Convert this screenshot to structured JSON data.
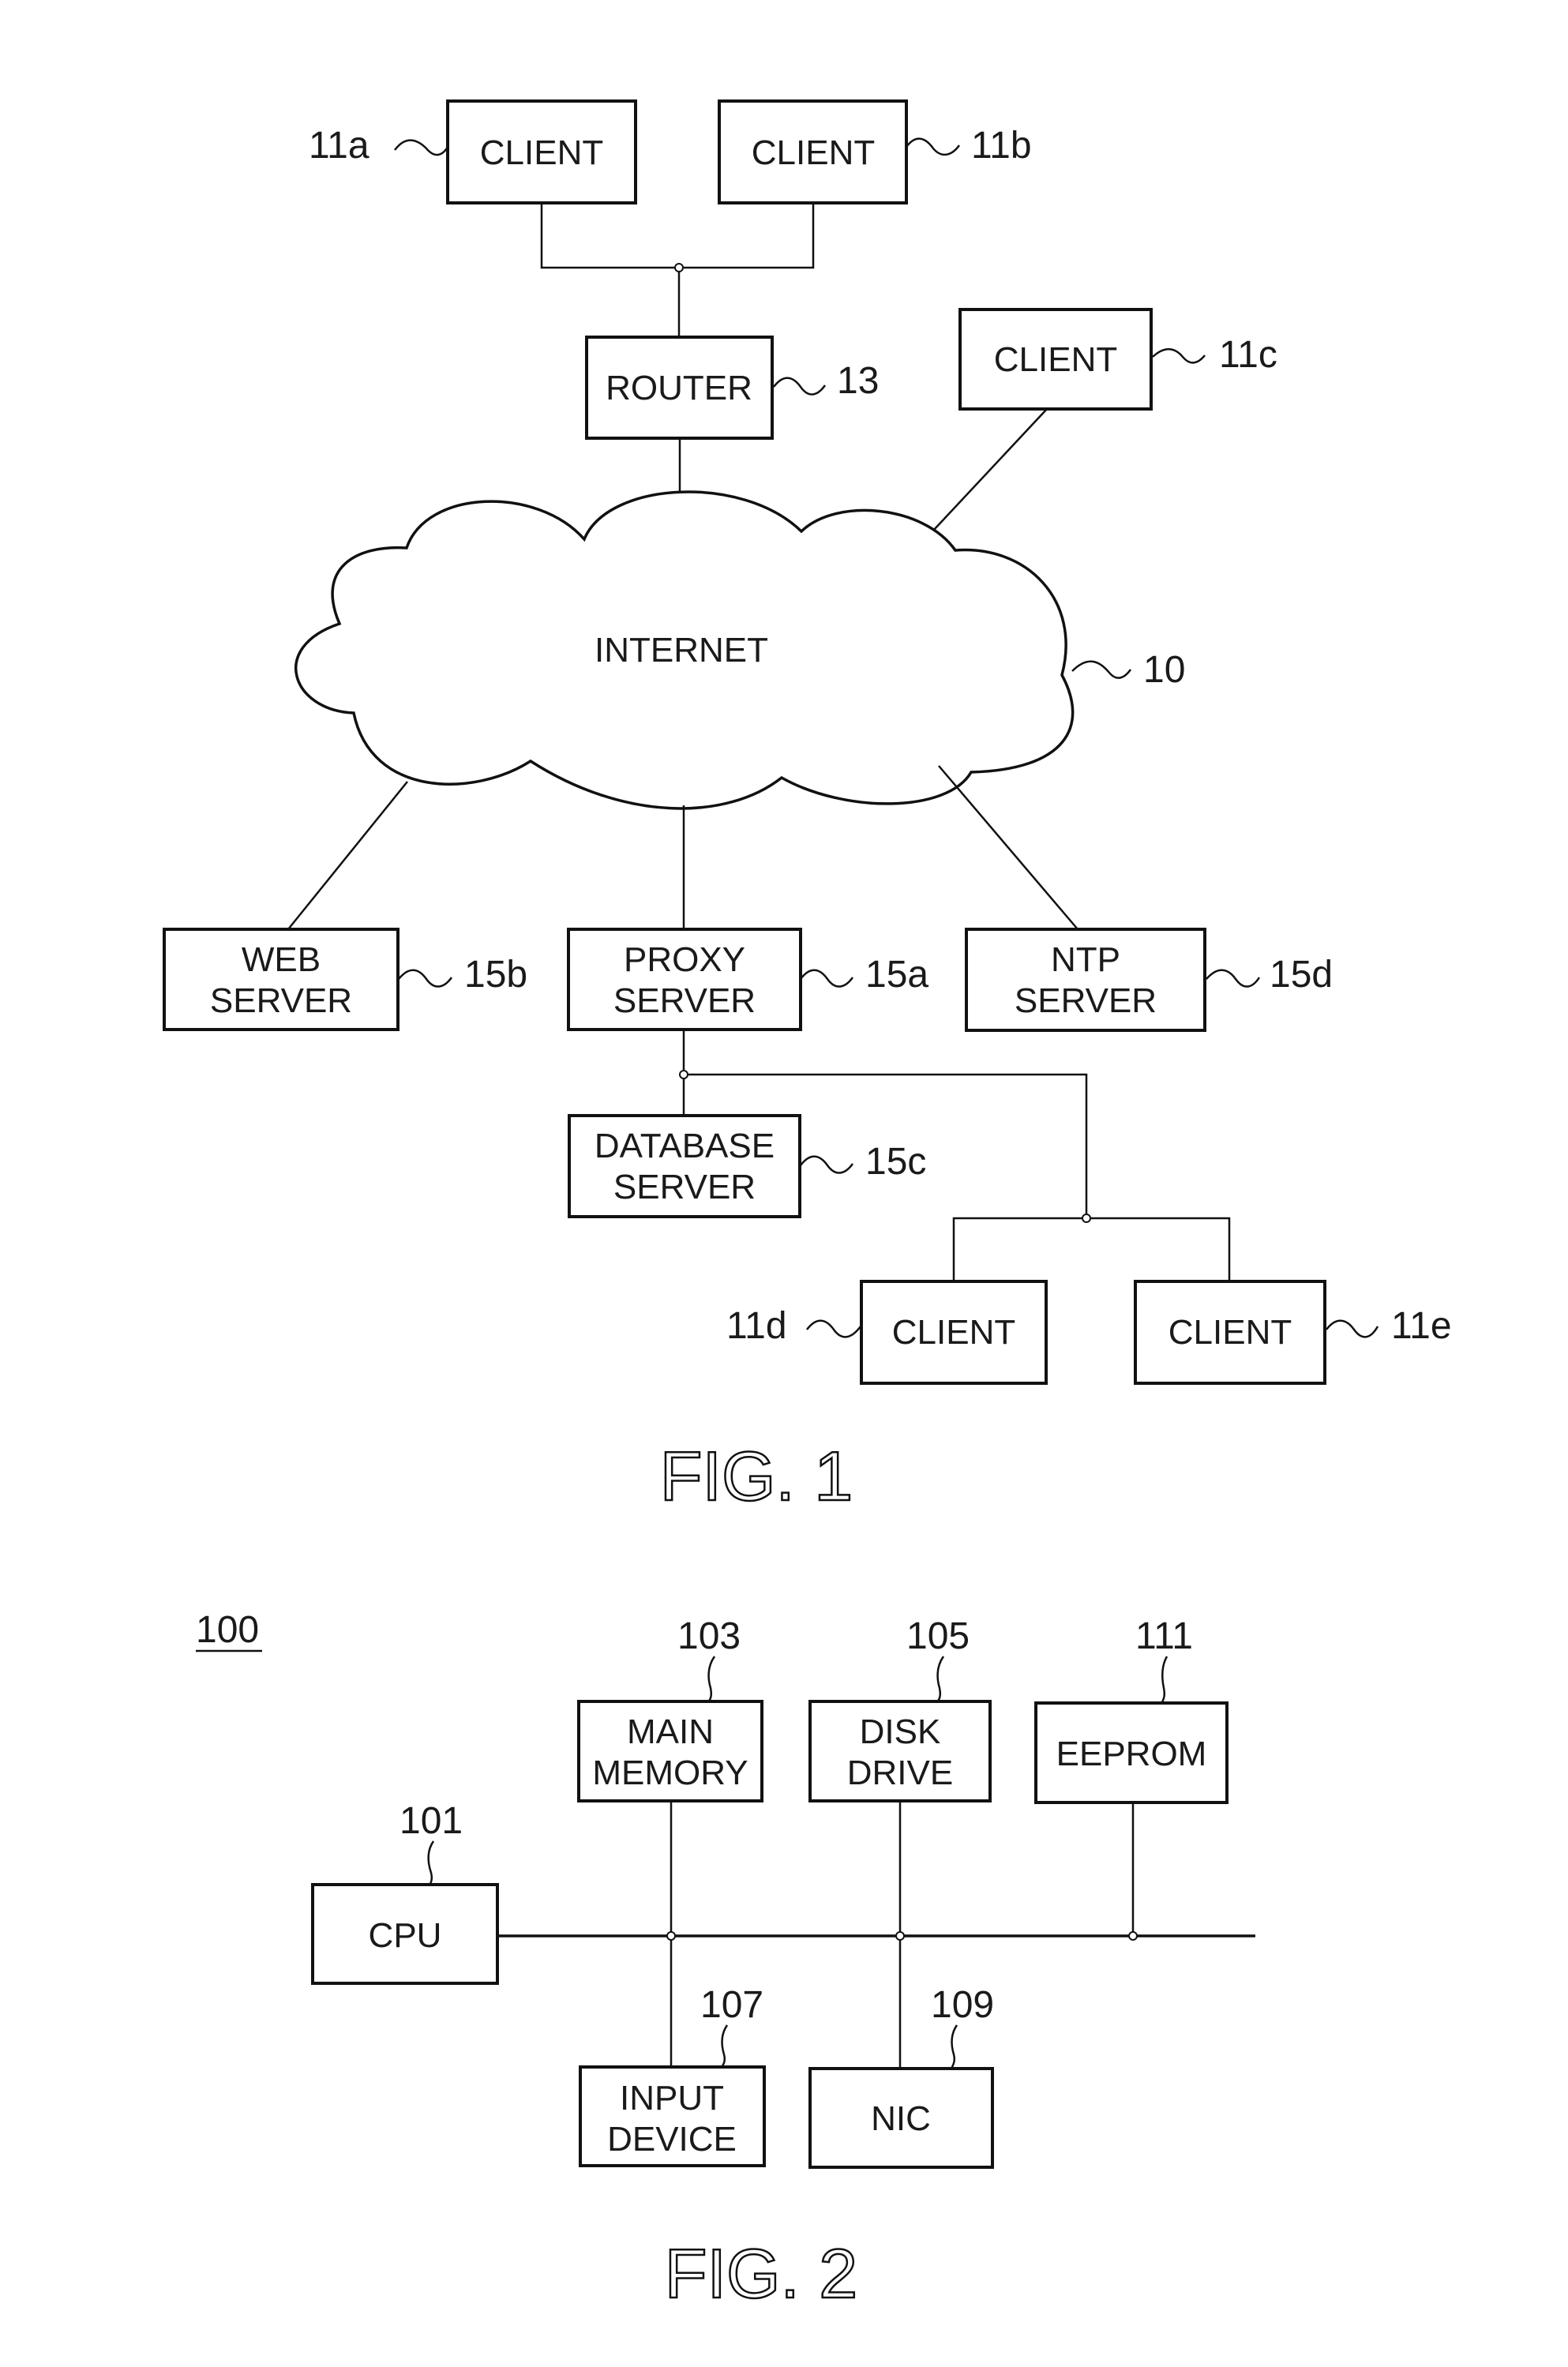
{
  "fig1": {
    "title": "FIG. 1",
    "network": {
      "label": "INTERNET",
      "ref": "10"
    },
    "router": {
      "label": "ROUTER",
      "ref": "13"
    },
    "clients": [
      {
        "label": "CLIENT",
        "ref": "11a"
      },
      {
        "label": "CLIENT",
        "ref": "11b"
      },
      {
        "label": "CLIENT",
        "ref": "11c"
      },
      {
        "label": "CLIENT",
        "ref": "11d"
      },
      {
        "label": "CLIENT",
        "ref": "11e"
      }
    ],
    "servers": {
      "web": {
        "line1": "WEB",
        "line2": "SERVER",
        "ref": "15b"
      },
      "proxy": {
        "line1": "PROXY",
        "line2": "SERVER",
        "ref": "15a"
      },
      "ntp": {
        "line1": "NTP",
        "line2": "SERVER",
        "ref": "15d"
      },
      "database": {
        "line1": "DATABASE",
        "line2": "SERVER",
        "ref": "15c"
      }
    }
  },
  "fig2": {
    "title": "FIG. 2",
    "system_ref": "100",
    "cpu": {
      "label": "CPU",
      "ref": "101"
    },
    "main_memory": {
      "line1": "MAIN",
      "line2": "MEMORY",
      "ref": "103"
    },
    "disk_drive": {
      "line1": "DISK",
      "line2": "DRIVE",
      "ref": "105"
    },
    "input_device": {
      "line1": "INPUT",
      "line2": "DEVICE",
      "ref": "107"
    },
    "nic": {
      "label": "NIC",
      "ref": "109"
    },
    "eeprom": {
      "label": "EEPROM",
      "ref": "111"
    }
  }
}
